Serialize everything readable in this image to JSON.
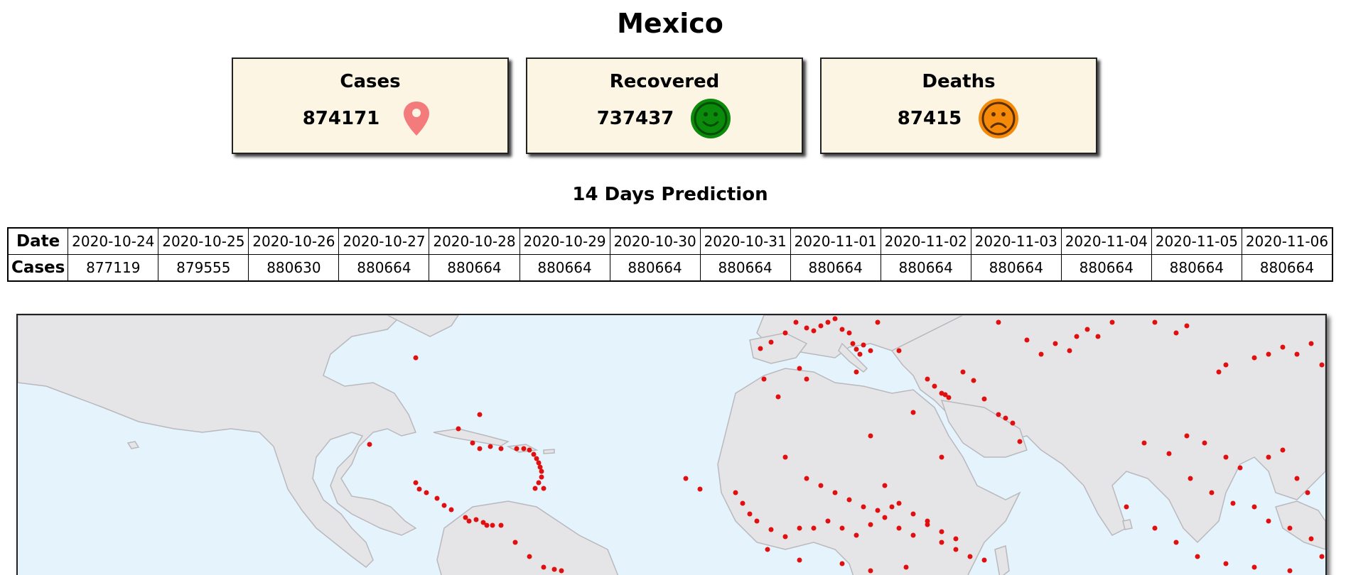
{
  "country": "Mexico",
  "cards": [
    {
      "label": "Cases",
      "value": "874171",
      "icon": "location-pin-icon",
      "color": "#f47b7b"
    },
    {
      "label": "Recovered",
      "value": "737437",
      "icon": "smiley-face-icon",
      "color": "#0b8a0b"
    },
    {
      "label": "Deaths",
      "value": "87415",
      "icon": "sad-face-icon",
      "color": "#f58a0a"
    }
  ],
  "prediction": {
    "title": "14 Days Prediction",
    "row_headers": {
      "date": "Date",
      "cases": "Cases"
    },
    "dates": [
      "2020-10-24",
      "2020-10-25",
      "2020-10-26",
      "2020-10-27",
      "2020-10-28",
      "2020-10-29",
      "2020-10-30",
      "2020-10-31",
      "2020-11-01",
      "2020-11-02",
      "2020-11-03",
      "2020-11-04",
      "2020-11-05",
      "2020-11-06"
    ],
    "cases": [
      "877119",
      "879555",
      "880630",
      "880664",
      "880664",
      "880664",
      "880664",
      "880664",
      "880664",
      "880664",
      "880664",
      "880664",
      "880664",
      "880664"
    ]
  },
  "map": {
    "ocean_color": "#e5f4fc",
    "land_color": "#e5e5e7",
    "marker_color": "#e01010"
  }
}
